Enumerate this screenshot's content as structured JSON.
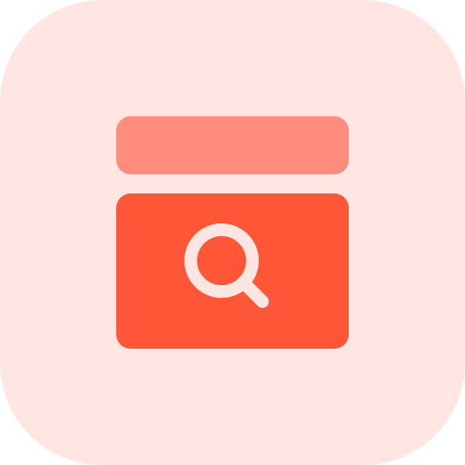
{
  "icon": {
    "name": "archive-search-icon",
    "colors": {
      "tile_background": "#FFE6E2",
      "lid": "#FF8C7D",
      "box": "#FF5638",
      "magnifier": "#FFE6E2"
    }
  }
}
